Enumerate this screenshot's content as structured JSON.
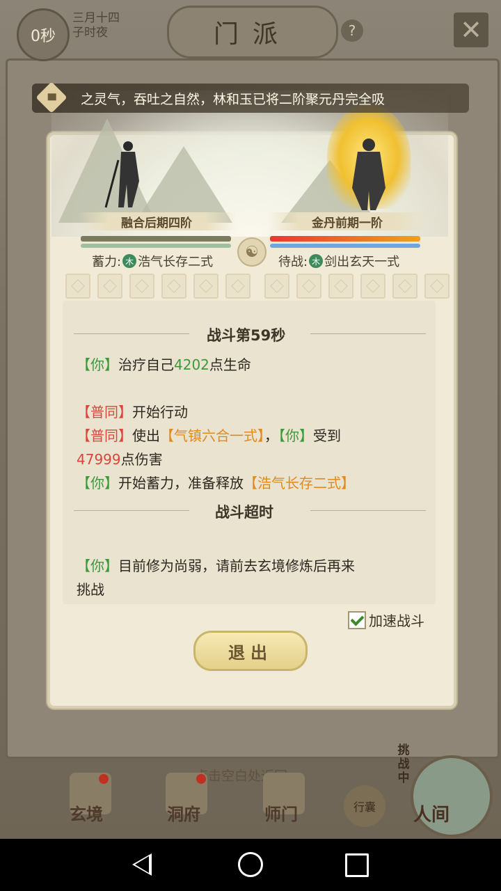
{
  "topbar": {
    "timer": "0秒",
    "date_line1": "三月十四",
    "date_line2": "子时夜",
    "title": "门派",
    "help": "?",
    "close": "✕"
  },
  "marquee": {
    "text": "之灵气，吞吐之自然，林和玉已将二阶聚元丹完全吸"
  },
  "battle": {
    "left_name": "融合后期四阶",
    "right_name": "金丹前期一阶",
    "left_status_prefix": "蓄力:",
    "left_status_element": "木",
    "left_status_skill": "浩气长存二式",
    "right_status_prefix": "待战:",
    "right_status_element": "木",
    "right_status_skill": "剑出玄天一式",
    "taiji": "☯"
  },
  "log": {
    "title1": "战斗第59秒",
    "l1_open": "【你】",
    "l1_a": "治疗自己",
    "l1_num": "4202",
    "l1_b": "点生命",
    "l2_open": "【普同】",
    "l2_a": "开始行动",
    "l3_open": "【普同】",
    "l3_a": "使出",
    "l3_skill": "【气镇六合一式】",
    "l3_b": "，",
    "l3_you": "【你】",
    "l3_c": "受到",
    "l4_num": "47999",
    "l4_a": "点伤害",
    "l5_open": "【你】",
    "l5_a": "开始蓄力，准备释放",
    "l5_skill": "【浩气长存二式】",
    "title2": "战斗超时",
    "l6_open": "【你】",
    "l6_a": "目前修为尚弱，请前去玄境修炼后再来",
    "l7_a": "挑战"
  },
  "controls": {
    "accelerate_label": "加速战斗",
    "accelerate_checked": true,
    "exit_label": "退出"
  },
  "bottom_nav": {
    "hint": "点击空白处返回",
    "items": [
      "玄境",
      "洞府",
      "师门"
    ],
    "bag_label": "行囊",
    "challenge_label": "挑战中",
    "world_label": "人间"
  },
  "colors": {
    "green_text": "#3a9a3a",
    "red_text": "#d9463a",
    "orange_text": "#e08a20",
    "panel_bg": "#f1ead7"
  }
}
